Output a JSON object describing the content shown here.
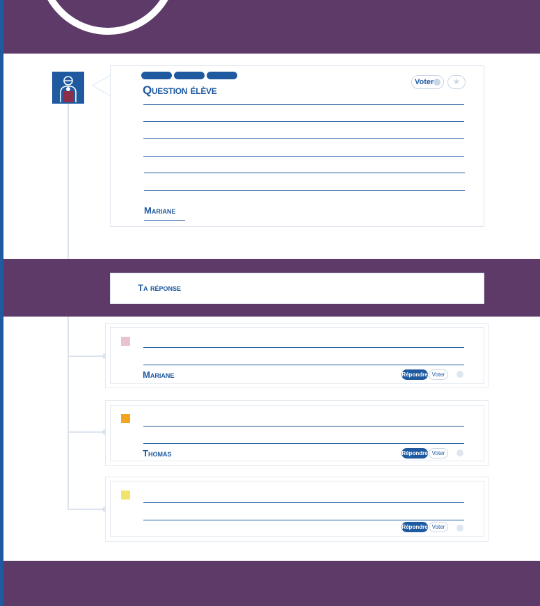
{
  "question": {
    "title": "Question élève",
    "vote_label": "Voter",
    "author": "Mariane",
    "star_icon": "star-icon"
  },
  "answer": {
    "label": "Ta réponse"
  },
  "replies": [
    {
      "author": "Mariane",
      "swatch_color": "#e8c4d0",
      "reply_label": "Répondre",
      "vote_label": "Voter"
    },
    {
      "author": "Thomas",
      "swatch_color": "#f2a51f",
      "reply_label": "Répondre",
      "vote_label": "Voter"
    },
    {
      "author": "",
      "swatch_color": "#f1e46a",
      "reply_label": "Répondre",
      "vote_label": "Voter"
    }
  ],
  "colors": {
    "accent": "#1f5aa0",
    "band": "#5e3a69"
  }
}
